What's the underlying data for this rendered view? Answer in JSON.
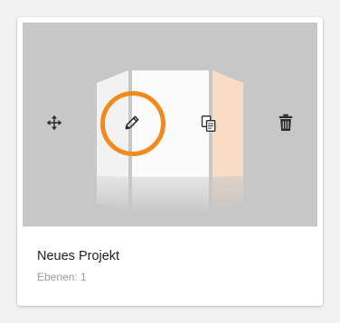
{
  "project_card": {
    "title": "Neues Projekt",
    "layers_text": "Ebenen: 1",
    "actions": [
      {
        "id": "move",
        "icon": "move-arrows-icon"
      },
      {
        "id": "edit",
        "icon": "pencil-icon",
        "highlighted": true
      },
      {
        "id": "duplicate",
        "icon": "copy-icon"
      },
      {
        "id": "delete",
        "icon": "trash-icon"
      }
    ]
  },
  "colors": {
    "preview_background": "#c7c7c7",
    "highlight_ring": "#f18a1c",
    "accent_panel": "#f9dcc4",
    "icon": "#2a2a2a"
  }
}
